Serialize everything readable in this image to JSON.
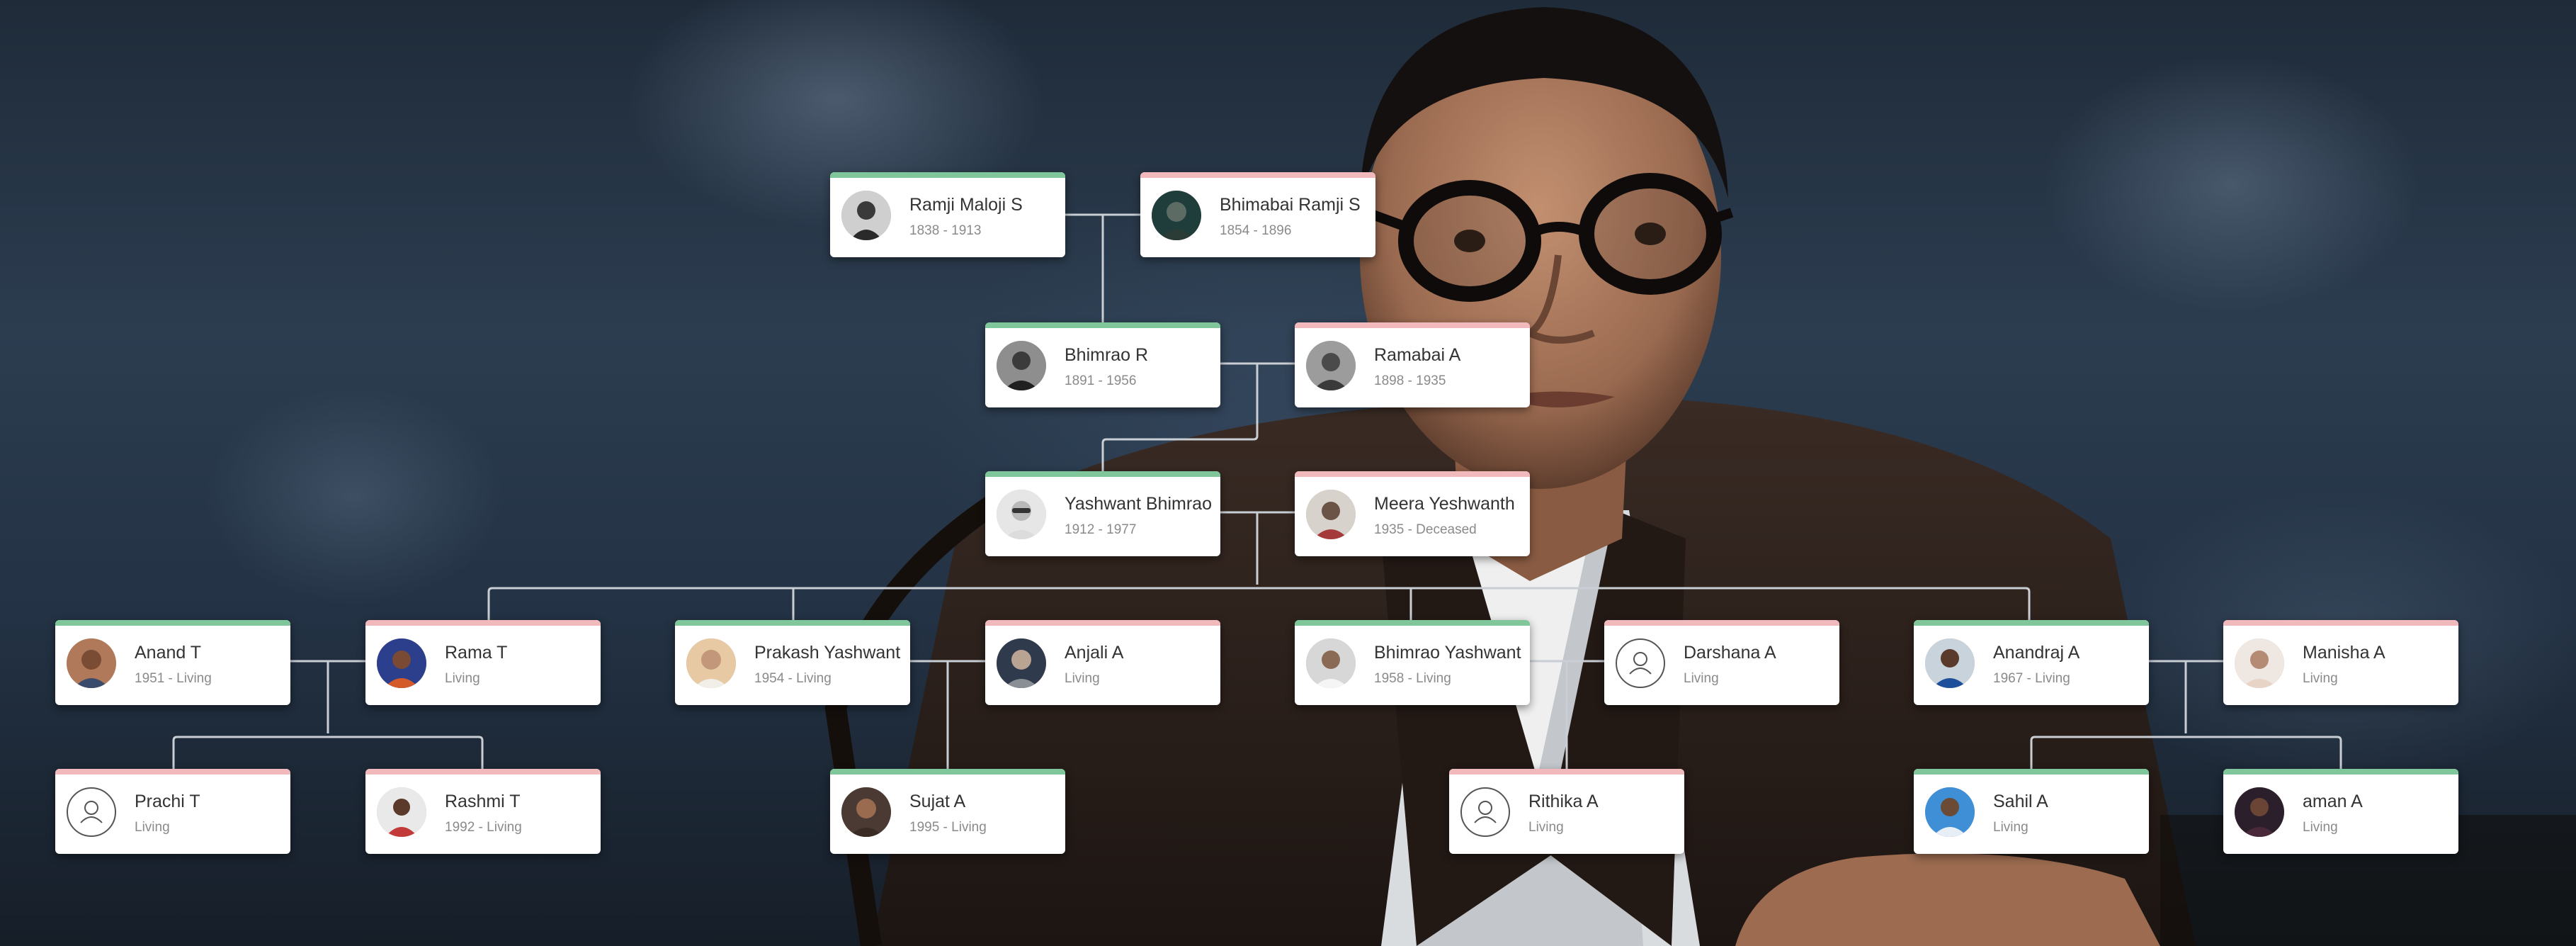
{
  "colors": {
    "male_accent": "#7fc79a",
    "female_accent": "#f2b9bd",
    "connector": "#c9ced4",
    "card_bg": "#ffffff"
  },
  "people": {
    "ramji": {
      "name": "Ramji Maloji S",
      "dates": "1838 - 1913",
      "gender": "male",
      "avatar": "photo"
    },
    "bhimabai": {
      "name": "Bhimabai Ramji S",
      "dates": "1854 - 1896",
      "gender": "female",
      "avatar": "photo"
    },
    "bhimrao": {
      "name": "Bhimrao R",
      "dates": "1891 - 1956",
      "gender": "male",
      "avatar": "photo"
    },
    "ramabai": {
      "name": "Ramabai A",
      "dates": "1898 - 1935",
      "gender": "female",
      "avatar": "photo"
    },
    "yashwant": {
      "name": "Yashwant Bhimrao",
      "dates": "1912 - 1977",
      "gender": "male",
      "avatar": "photo"
    },
    "meera": {
      "name": "Meera Yeshwanth",
      "dates": "1935 - Deceased",
      "gender": "female",
      "avatar": "photo"
    },
    "anand": {
      "name": "Anand T",
      "dates": "1951 - Living",
      "gender": "male",
      "avatar": "photo"
    },
    "rama": {
      "name": "Rama T",
      "dates": "Living",
      "gender": "female",
      "avatar": "photo"
    },
    "prakash": {
      "name": "Prakash Yashwant",
      "dates": "1954 - Living",
      "gender": "male",
      "avatar": "photo"
    },
    "anjali": {
      "name": "Anjali A",
      "dates": "Living",
      "gender": "female",
      "avatar": "photo"
    },
    "bhimrao_y": {
      "name": "Bhimrao Yashwant",
      "dates": "1958 - Living",
      "gender": "male",
      "avatar": "photo"
    },
    "darshana": {
      "name": "Darshana A",
      "dates": "Living",
      "gender": "female",
      "avatar": "placeholder"
    },
    "anandraj": {
      "name": "Anandraj A",
      "dates": "1967 - Living",
      "gender": "male",
      "avatar": "photo"
    },
    "manisha": {
      "name": "Manisha A",
      "dates": "Living",
      "gender": "female",
      "avatar": "photo"
    },
    "prachi": {
      "name": "Prachi T",
      "dates": "Living",
      "gender": "female",
      "avatar": "placeholder"
    },
    "rashmi": {
      "name": "Rashmi T",
      "dates": "1992 - Living",
      "gender": "female",
      "avatar": "photo"
    },
    "sujat": {
      "name": "Sujat A",
      "dates": "1995 - Living",
      "gender": "male",
      "avatar": "photo"
    },
    "rithika": {
      "name": "Rithika A",
      "dates": "Living",
      "gender": "female",
      "avatar": "placeholder"
    },
    "sahil": {
      "name": "Sahil A",
      "dates": "Living",
      "gender": "male",
      "avatar": "photo"
    },
    "aman": {
      "name": "aman A",
      "dates": "Living",
      "gender": "male",
      "avatar": "photo"
    }
  }
}
